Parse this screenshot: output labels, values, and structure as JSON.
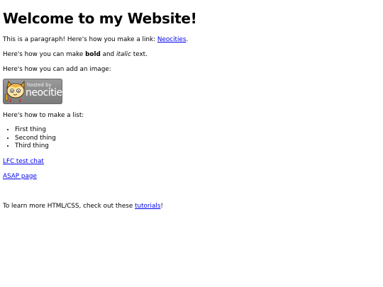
{
  "heading": "Welcome to my Website!",
  "intro": {
    "text": "This is a paragraph! Here's how you make a link: ",
    "link": "Neocities",
    "end": "."
  },
  "bold_line": {
    "before": "Here's how you can make ",
    "bold": "bold",
    "middle": " and ",
    "italic": "italic",
    "after": " text."
  },
  "image_line": "Here's how you can add an image:",
  "badge": {
    "line1": "hosted by",
    "line2": "neocities"
  },
  "list_line": "Here's how to make a list:",
  "list_items": [
    "First thing",
    "Second thing",
    "Third thing"
  ],
  "links": {
    "chat": "LFC test chat",
    "asap": "ASAP page"
  },
  "tutorials": {
    "before": "To learn more HTML/CSS, check out these ",
    "link": "tutorials",
    "after": "!"
  }
}
